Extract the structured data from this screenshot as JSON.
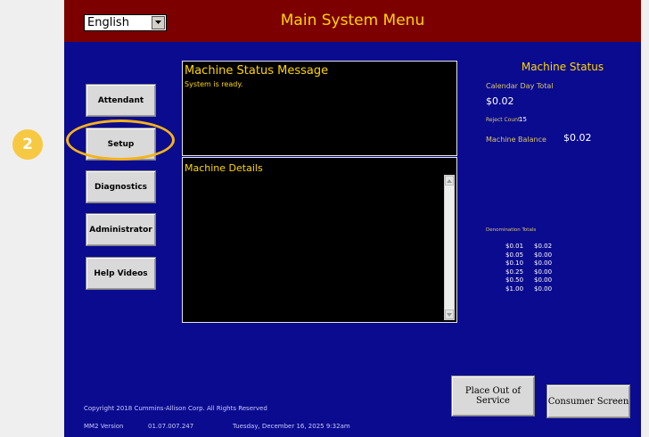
{
  "header": {
    "language": "English",
    "title": "Main System Menu"
  },
  "menu": {
    "attendant": "Attendant",
    "setup": "Setup",
    "diagnostics": "Diagnostics",
    "administrator": "Administrator",
    "help_videos": "Help Videos"
  },
  "status_panel": {
    "title": "Machine Status Message",
    "message": "System is ready."
  },
  "details_panel": {
    "title": "Machine Details"
  },
  "machine_status": {
    "title": "Machine Status",
    "calendar_day_total_label": "Calendar Day Total",
    "calendar_day_total": "$0.02",
    "reject_count_label": "Reject Count",
    "reject_count": "15",
    "machine_balance_label": "Machine Balance",
    "machine_balance": "$0.02",
    "denomination_totals_label": "Denomination Totals",
    "denominations": [
      {
        "denom": "$0.01",
        "total": "$0.02"
      },
      {
        "denom": "$0.05",
        "total": "$0.00"
      },
      {
        "denom": "$0.10",
        "total": "$0.00"
      },
      {
        "denom": "$0.25",
        "total": "$0.00"
      },
      {
        "denom": "$0.50",
        "total": "$0.00"
      },
      {
        "denom": "$1.00",
        "total": "$0.00"
      }
    ]
  },
  "actions": {
    "place_out_of_service": "Place Out of Service",
    "consumer_screen": "Consumer Screen"
  },
  "footer": {
    "copyright": "Copyright 2018 Cummins-Allison Corp. All Rights Reserved",
    "version_label": "MM2 Version",
    "version": "01.07.007.247",
    "datetime": "Tuesday, December 16, 2025 9:32am"
  },
  "annotation": {
    "step": "2"
  },
  "colors": {
    "background": "#0b0b8f",
    "header": "#7c0000",
    "accent": "#ffd600",
    "highlight": "#f5b21a"
  }
}
